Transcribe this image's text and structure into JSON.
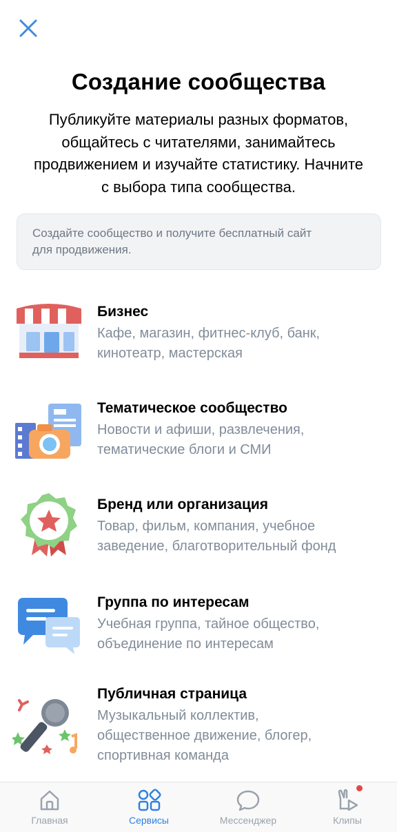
{
  "header": {
    "close_icon": "close-icon",
    "title": "Создание сообщества",
    "subtitle_lines": [
      "Публикуйте материалы разных форматов,",
      "общайтесь с читателями, занимайтесь",
      "продвижением и изучайте статистику. Начните",
      "с выбора типа сообщества."
    ]
  },
  "info": {
    "lines": [
      "Создайте сообщество и получите бесплатный сайт",
      "для продвижения."
    ]
  },
  "options": [
    {
      "icon": "storefront-icon",
      "title": "Бизнес",
      "desc": [
        "Кафе, магазин, фитнес-клуб, банк,",
        "кинотеатр, мастерская"
      ]
    },
    {
      "icon": "media-camera-icon",
      "title": "Тематическое сообщество",
      "desc": [
        "Новости и афиши, развлечения,",
        "тематические блоги и СМИ"
      ]
    },
    {
      "icon": "badge-star-icon",
      "title": "Бренд или организация",
      "desc": [
        "Товар, фильм, компания, учебное",
        "заведение, благотворительный фонд"
      ]
    },
    {
      "icon": "chat-bubbles-icon",
      "title": "Группа по интересам",
      "desc": [
        "Учебная группа, тайное общество,",
        "объединение по интересам"
      ]
    },
    {
      "icon": "microphone-icon",
      "title": "Публичная страница",
      "desc": [
        "Музыкальный коллектив,",
        "общественное движение, блогер,",
        "спортивная команда"
      ]
    }
  ],
  "tabbar": {
    "active": "Сервисы",
    "tabs": [
      {
        "label": "Главная",
        "icon": "home-icon"
      },
      {
        "label": "Сервисы",
        "icon": "services-grid-icon"
      },
      {
        "label": "Мессенджер",
        "icon": "message-bubble-icon"
      },
      {
        "label": "Клипы",
        "icon": "clips-icon",
        "badge": true
      }
    ]
  },
  "colors": {
    "accent": "#2d81e0",
    "secondary_text": "#818c99",
    "badge": "#e64646"
  }
}
